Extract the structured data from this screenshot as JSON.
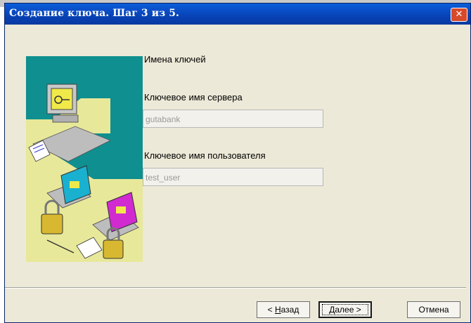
{
  "window": {
    "title": "Создание ключа. Шаг 3 из 5.",
    "close_glyph": "✕"
  },
  "section": {
    "heading": "Имена ключей"
  },
  "server_key": {
    "label": "Ключевое имя сервера",
    "value": "gutabank"
  },
  "user_key": {
    "label": "Ключевое имя пользователя",
    "value": "test_user"
  },
  "buttons": {
    "back": {
      "prefix": "< ",
      "mnemonic": "Н",
      "rest": "азад"
    },
    "next": {
      "mnemonic": "Д",
      "rest": "алее >"
    },
    "cancel": "Отмена"
  },
  "colors": {
    "titlebar": "#0a4fc9",
    "dialog_bg": "#ece9d8",
    "illustration_teal": "#0f8f8f",
    "illustration_yellow": "#e8e89a"
  },
  "icons": [
    "close-icon",
    "wizard-illustration"
  ]
}
